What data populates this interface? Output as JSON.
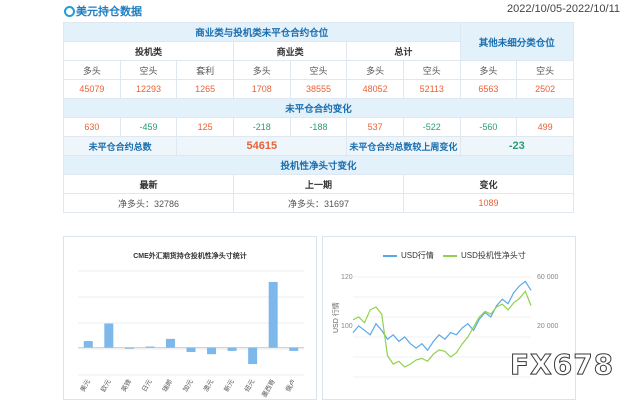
{
  "header": {
    "title": "美元持仓数据",
    "date_range": "2022/10/05-2022/10/11",
    "icon": "circle-icon",
    "accent": "#1f9fd6"
  },
  "table": {
    "group_title": "商业类与投机类未平仓合约仓位",
    "other_title": "其他未细分类仓位",
    "spec_title": "投机类",
    "comm_title": "商业类",
    "total_title": "总计",
    "col_labels": [
      "多头",
      "空头",
      "套利",
      "多头",
      "空头",
      "多头",
      "空头",
      "多头",
      "空头"
    ],
    "values": [
      "45079",
      "12293",
      "1265",
      "1708",
      "38555",
      "48052",
      "52113",
      "6563",
      "2502"
    ],
    "change_title": "未平仓合约变化",
    "changes": [
      "630",
      "-459",
      "125",
      "-218",
      "-188",
      "537",
      "-522",
      "-560",
      "499"
    ],
    "oi_total_label": "未平仓合约总数",
    "oi_total_value": "54615",
    "oi_change_label": "未平仓合约总数较上周变化",
    "oi_change_value": "-23",
    "net_title": "投机性净头寸变化",
    "net_cols": [
      "最新",
      "上一期",
      "变化"
    ],
    "net_values": [
      "净多头：32786",
      "净多头：31697",
      "1089"
    ]
  },
  "bar_chart": {
    "title": "CME外汇期货持仓投机性净头寸统计"
  },
  "line_chart": {
    "legend_usd": "USD行情",
    "legend_net": "USD投机性净头寸",
    "ylabel_left": "USD 行情",
    "left_ticks": [
      "120",
      "100"
    ],
    "right_ticks": [
      "60 000",
      "20 000"
    ],
    "colors": {
      "usd": "#5aa9e6",
      "net": "#8fd14f"
    }
  },
  "chart_data": [
    {
      "type": "bar",
      "title": "CME外汇期货持仓投机性净头寸统计",
      "categories": [
        "美元",
        "欧元",
        "英镑",
        "日元",
        "瑞郎",
        "加元",
        "澳元",
        "新元",
        "纽元",
        "墨西哥",
        "俄卢"
      ],
      "values": [
        6,
        22,
        -1,
        1,
        8,
        -4,
        -6,
        -3,
        -15,
        60,
        -3
      ],
      "grid": true,
      "color": "#7db8ea"
    },
    {
      "type": "line",
      "series": [
        {
          "name": "USD行情",
          "axis": "left",
          "values": [
            100,
            103,
            101,
            99,
            104,
            101,
            97,
            99,
            96,
            98,
            95,
            93,
            95,
            92,
            96,
            99,
            97,
            100,
            99,
            102,
            104,
            101,
            106,
            109,
            107,
            112,
            115,
            113,
            118,
            121,
            123,
            119
          ]
        },
        {
          "name": "USD投机性净头寸",
          "axis": "right",
          "values": [
            40000,
            42000,
            38000,
            47000,
            49000,
            44000,
            15000,
            9000,
            11000,
            7000,
            9000,
            12000,
            13000,
            11000,
            16000,
            19000,
            18000,
            14000,
            17000,
            23000,
            28000,
            35000,
            42000,
            46000,
            44000,
            49000,
            51000,
            47000,
            52000,
            55000,
            60000,
            50000
          ]
        }
      ],
      "left_axis_ticks": [
        "120",
        "100"
      ],
      "right_axis_ticks": [
        "60 000",
        "20 000"
      ],
      "ylim_left": [
        80,
        125
      ],
      "ylim_right": [
        0,
        70000
      ],
      "legend": "top"
    }
  ],
  "watermark": "FX678"
}
